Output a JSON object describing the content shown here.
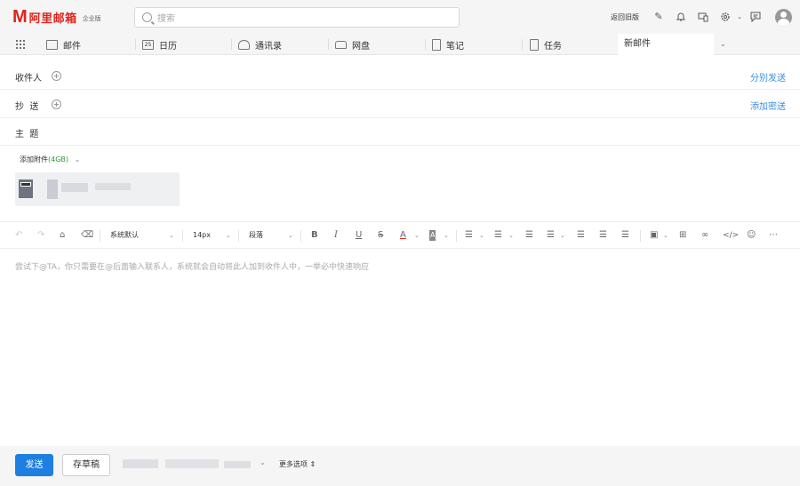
{
  "header": {
    "logo_mark": "M",
    "logo_text": "阿里邮箱",
    "logo_edition": "企业版",
    "search_placeholder": "搜索",
    "old_version": "返回旧版"
  },
  "nav": {
    "items": [
      {
        "label": "邮件",
        "icon": "mail-icon"
      },
      {
        "label": "日历",
        "icon": "calendar-icon"
      },
      {
        "label": "通讯录",
        "icon": "contacts-icon"
      },
      {
        "label": "网盘",
        "icon": "drive-icon"
      },
      {
        "label": "笔记",
        "icon": "notes-icon"
      },
      {
        "label": "任务",
        "icon": "tasks-icon"
      }
    ],
    "calendar_day": "25",
    "active_tab": "新邮件"
  },
  "compose": {
    "to_label": "收件人",
    "cc_label": "抄  送",
    "subject_label": "主  题",
    "separate_send": "分别发送",
    "add_bcc": "添加密送",
    "attach_label": "添加附件",
    "attach_size": "(4GB)",
    "attachment_badge": "DOC"
  },
  "toolbar": {
    "font_family": "系统默认",
    "font_size": "14px",
    "paragraph": "段落"
  },
  "editor": {
    "placeholder": "尝试下@TA，你只需要在@后面输入联系人，系统就会自动将此人加到收件人中，一举必中快速响应"
  },
  "footer": {
    "send": "发送",
    "draft": "存草稿",
    "more_options": "更多选项"
  },
  "colors": {
    "brand": "#e2231a",
    "link": "#3a8ee6",
    "send_button": "#1e7fe0",
    "attach_size": "#2a9a3a"
  }
}
